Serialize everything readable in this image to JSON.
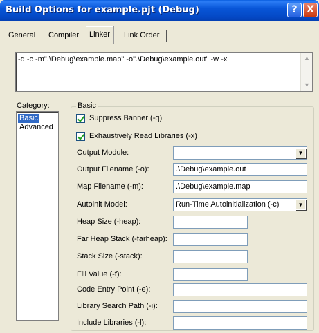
{
  "window": {
    "title": "Build Options for example.pjt (Debug)",
    "help_label": "?",
    "close_label": "X"
  },
  "tabs": [
    {
      "label": "General"
    },
    {
      "label": "Compiler"
    },
    {
      "label": "Linker",
      "active": true
    },
    {
      "label": "Link Order"
    }
  ],
  "command_line": "-q -c -m\".\\Debug\\example.map\" -o\".\\Debug\\example.out\" -w -x",
  "category": {
    "label": "Category:",
    "items": [
      {
        "label": "Basic",
        "selected": true
      },
      {
        "label": "Advanced"
      }
    ]
  },
  "basic": {
    "group_title": "Basic",
    "suppress_banner": {
      "label": "Suppress Banner (-q)",
      "checked": true
    },
    "exhaustive_read": {
      "label": "Exhaustively Read Libraries (-x)",
      "checked": true
    },
    "fields": [
      {
        "label": "Output Module:",
        "value": "",
        "type": "select"
      },
      {
        "label": "Output Filename (-o):",
        "value": ".\\Debug\\example.out",
        "type": "text"
      },
      {
        "label": "Map Filename (-m):",
        "value": ".\\Debug\\example.map",
        "type": "text"
      },
      {
        "label": "Autoinit Model:",
        "value": "Run-Time Autoinitialization (-c)",
        "type": "select"
      },
      {
        "label": "Heap Size (-heap):",
        "value": "",
        "type": "text"
      },
      {
        "label": "Far Heap Stack (-farheap):",
        "value": "",
        "type": "text"
      },
      {
        "label": "Stack Size (-stack):",
        "value": "",
        "type": "text"
      },
      {
        "label": "Fill Value (-f):",
        "value": "",
        "type": "text"
      },
      {
        "label": "Code Entry Point (-e):",
        "value": "",
        "type": "text"
      },
      {
        "label": "Library Search Path (-i):",
        "value": "",
        "type": "text"
      },
      {
        "label": "Include Libraries (-l):",
        "value": "",
        "type": "text"
      }
    ]
  },
  "icons": {
    "dropdown": "chevron-down-icon",
    "scroll_up": "arrow-up-icon",
    "scroll_down": "arrow-down-icon",
    "check": "checkmark-icon"
  }
}
